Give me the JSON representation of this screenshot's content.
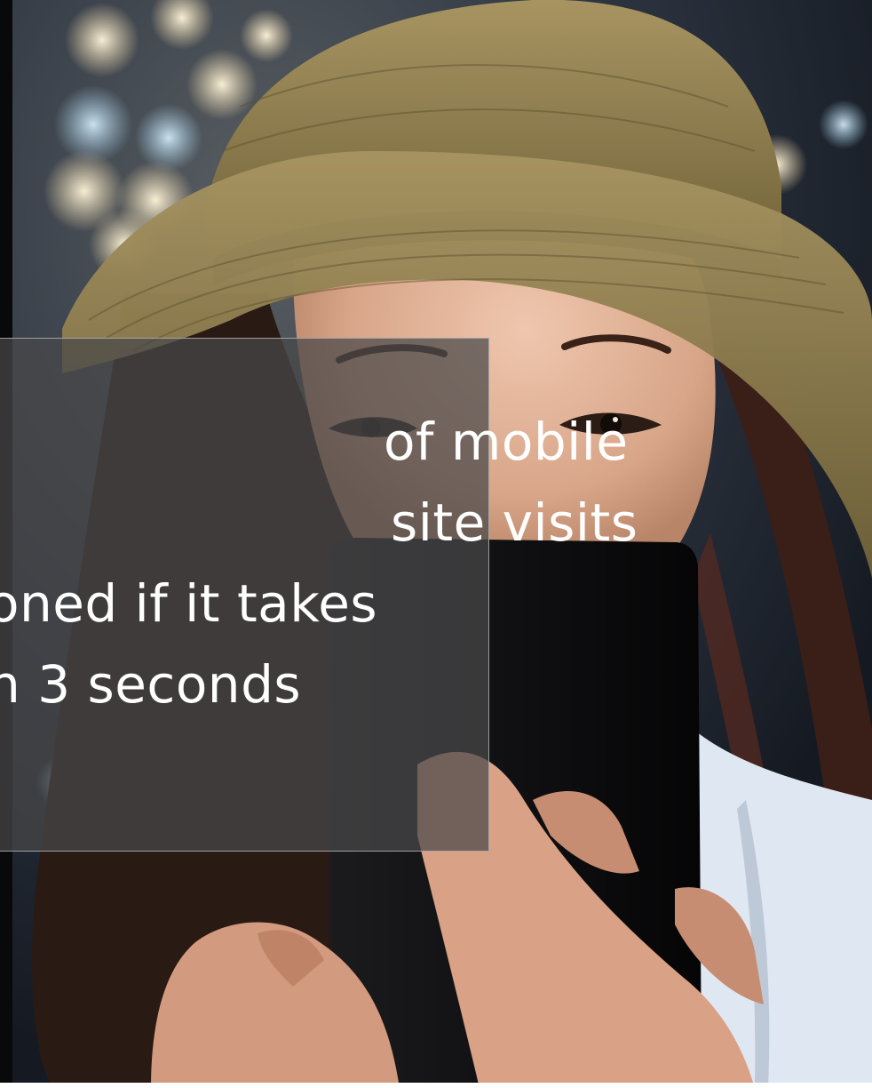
{
  "image": {
    "subject": "woman-in-straw-hat-looking-at-phone"
  },
  "overlay": {
    "lines": [
      "of mobile",
      "site visits",
      "oned if it takes",
      "n 3 seconds"
    ]
  },
  "colors": {
    "overlay_fill": "#48484a",
    "overlay_border": "#afafaf",
    "text": "#ffffff",
    "hat": "#8b7a4a",
    "skin": "#e4b59c",
    "hair": "#2a1a14",
    "phone": "#0a0a0c",
    "shirt": "#dfe7f3",
    "background": "#1e2530"
  }
}
